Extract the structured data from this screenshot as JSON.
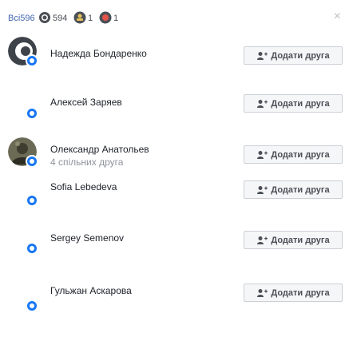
{
  "header": {
    "all_label": "Всі",
    "all_count": "596",
    "online_count": "594",
    "mobile_count": "1",
    "other_count": "1",
    "close_glyph": "×"
  },
  "colors": {
    "accent": "#4267b2",
    "button_bg": "#f5f6f7",
    "button_border": "#ccd0d5",
    "status_blue": "#1877f2"
  },
  "icons": {
    "online": "online-status-icon",
    "mobile": "mobile-status-icon",
    "other": "other-status-icon",
    "add_friend": "add-friend-icon",
    "close": "close-icon"
  },
  "people": [
    {
      "name": "Надежда Бондаренко",
      "mutual": "",
      "add_label": "Додати друга",
      "status": "online"
    },
    {
      "name": "Алексей Заряев",
      "mutual": "",
      "add_label": "Додати друга",
      "status": "online"
    },
    {
      "name": "Олександр Анатольев",
      "mutual": "4 спільних друга",
      "add_label": "Додати друга",
      "status": "online"
    },
    {
      "name": "Sofia Lebedeva",
      "mutual": "",
      "add_label": "Додати друга",
      "status": "online"
    },
    {
      "name": "Sergey Semenov",
      "mutual": "",
      "add_label": "Додати друга",
      "status": "online"
    },
    {
      "name": "Гульжан Аскарова",
      "mutual": "",
      "add_label": "Додати друга",
      "status": "online"
    }
  ]
}
